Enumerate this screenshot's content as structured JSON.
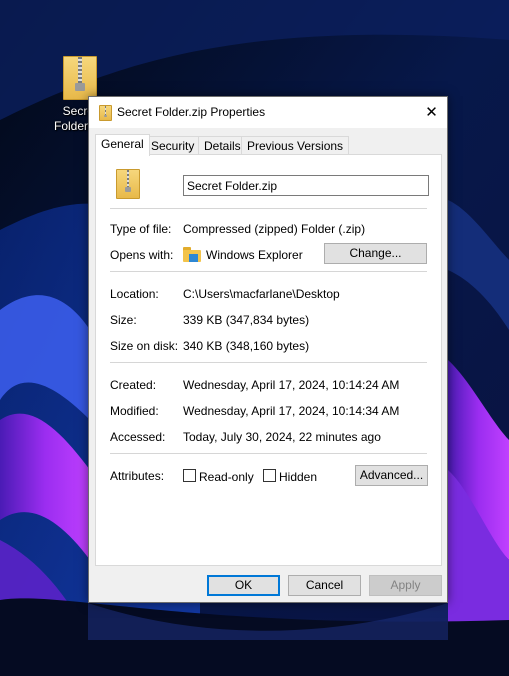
{
  "desktop": {
    "icon_label_line1": "Secret",
    "icon_label_line2": "Folder.zip"
  },
  "dialog": {
    "title": "Secret Folder.zip Properties",
    "close_glyph": "✕",
    "tabs": [
      "General",
      "Security",
      "Details",
      "Previous Versions"
    ],
    "active_tab": "General",
    "general": {
      "file_name": "Secret Folder.zip",
      "type_label": "Type of file:",
      "type_value": "Compressed (zipped) Folder (.zip)",
      "opens_label": "Opens with:",
      "opens_value": "Windows Explorer",
      "change_button": "Change...",
      "location_label": "Location:",
      "location_value": "C:\\Users\\macfarlane\\Desktop",
      "size_label": "Size:",
      "size_value": "339 KB (347,834 bytes)",
      "size_on_disk_label": "Size on disk:",
      "size_on_disk_value": "340 KB (348,160 bytes)",
      "created_label": "Created:",
      "created_value": "Wednesday, April 17, 2024, 10:14:24 AM",
      "modified_label": "Modified:",
      "modified_value": "Wednesday, April 17, 2024, 10:14:34 AM",
      "accessed_label": "Accessed:",
      "accessed_value": "Today, July 30, 2024, 22 minutes ago",
      "attributes_label": "Attributes:",
      "readonly_label": "Read-only",
      "hidden_label": "Hidden",
      "advanced_button": "Advanced..."
    },
    "buttons": {
      "ok": "OK",
      "cancel": "Cancel",
      "apply": "Apply"
    }
  },
  "colors": {
    "accent": "#0078d7",
    "dialog_bg": "#f0f0f0",
    "button_bg": "#e1e1e1",
    "desktop_purple": "#8a2be2"
  },
  "icons": {
    "file": "zip-folder-icon",
    "opens_with": "file-explorer-icon",
    "close": "close-icon"
  }
}
